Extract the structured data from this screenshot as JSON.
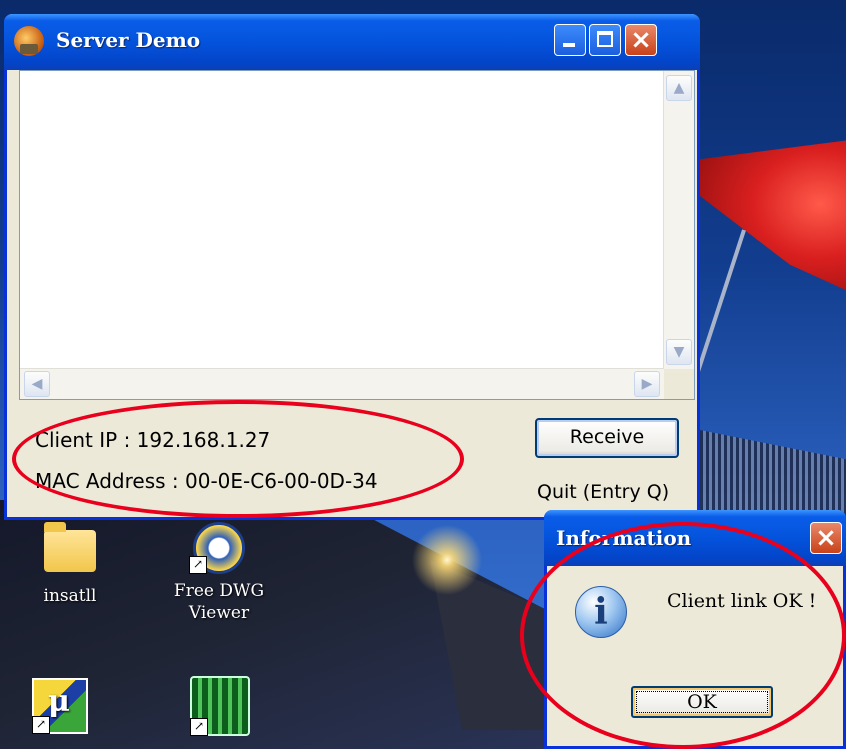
{
  "window": {
    "title": "Server Demo",
    "controls": {
      "minimize": "minimize-icon",
      "maximize": "maximize-icon",
      "close": "close-icon"
    }
  },
  "scroll": {
    "up": "▲",
    "down": "▼",
    "left": "◀",
    "right": "▶"
  },
  "status": {
    "client_ip_label": "Client IP : 192.168.1.27",
    "mac_label": "MAC Address : 00-0E-C6-00-0D-34"
  },
  "buttons": {
    "receive": "Receive",
    "quit": "Quit (Entry Q)"
  },
  "desktop": {
    "icons": [
      {
        "label": "insatll"
      },
      {
        "label": "Free DWG\nViewer"
      }
    ]
  },
  "dialog": {
    "title": "Information",
    "close": "×",
    "message": "Client link OK !",
    "ok": "OK",
    "icon_glyph": "i"
  },
  "colors": {
    "xp_blue": "#0453dc",
    "annotation_red": "#e8001c",
    "window_face": "#ece9d8"
  }
}
